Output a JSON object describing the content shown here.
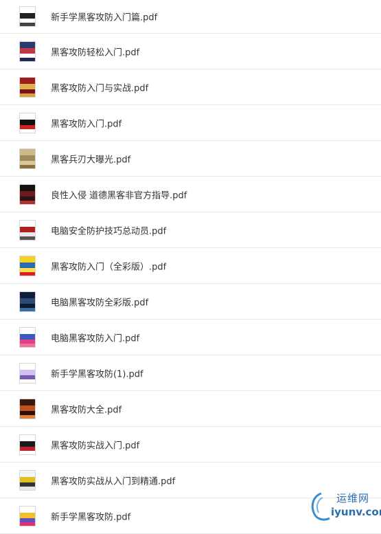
{
  "files": [
    {
      "name": "新手学黑客攻防入门篇.pdf",
      "thumb": [
        "#ffffff",
        "#222222",
        "#ffffff",
        "#444444"
      ]
    },
    {
      "name": "黑客攻防轻松入门.pdf",
      "thumb": [
        "#2a3a6e",
        "#c0384a",
        "#ffffff",
        "#1c2a55"
      ]
    },
    {
      "name": "黑客攻防入门与实战.pdf",
      "thumb": [
        "#9b1c1c",
        "#e0b050",
        "#7a1414",
        "#d8a040"
      ]
    },
    {
      "name": "黑客攻防入门.pdf",
      "thumb": [
        "#ffffff",
        "#111111",
        "#cc2222",
        "#ffffff"
      ]
    },
    {
      "name": "黑客兵刃大曝光.pdf",
      "thumb": [
        "#cdb88a",
        "#a08858",
        "#d9c79b",
        "#8a7040"
      ]
    },
    {
      "name": "良性入侵 道德黑客非官方指导.pdf",
      "thumb": [
        "#1a1010",
        "#6a1a1a",
        "#2a1515",
        "#b23030"
      ]
    },
    {
      "name": "电脑安全防护技巧总动员.pdf",
      "thumb": [
        "#ffffff",
        "#b02020",
        "#e8e8e8",
        "#555555"
      ]
    },
    {
      "name": "黑客攻防入门（全彩版）.pdf",
      "thumb": [
        "#f4d020",
        "#2a6ab0",
        "#f7e050",
        "#e02020"
      ]
    },
    {
      "name": "电脑黑客攻防全彩版.pdf",
      "thumb": [
        "#0f1f3a",
        "#2a4a7a",
        "#0a1a30",
        "#3a6aa0"
      ]
    },
    {
      "name": "电脑黑客攻防入门.pdf",
      "thumb": [
        "#ffffff",
        "#3a5ac0",
        "#e0408a",
        "#f070a0"
      ]
    },
    {
      "name": "新手学黑客攻防(1).pdf",
      "thumb": [
        "#ffffff",
        "#d0c0f0",
        "#7a5ab0",
        "#ffffff"
      ]
    },
    {
      "name": "黑客攻防大全.pdf",
      "thumb": [
        "#3a1a0a",
        "#c05020",
        "#2a1005",
        "#e08030"
      ]
    },
    {
      "name": "黑客攻防实战入门.pdf",
      "thumb": [
        "#ffffff",
        "#1a1a1a",
        "#c02030",
        "#ffffff"
      ]
    },
    {
      "name": "黑客攻防实战从入门到精通.pdf",
      "thumb": [
        "#f4f4f4",
        "#e0c020",
        "#333333",
        "#e8e8e8"
      ]
    },
    {
      "name": "新手学黑客攻防.pdf",
      "thumb": [
        "#ffffff",
        "#f0c030",
        "#6050c0",
        "#e03070"
      ]
    }
  ],
  "watermark": {
    "line1": "运维网",
    "line2": "iyunv.com"
  }
}
